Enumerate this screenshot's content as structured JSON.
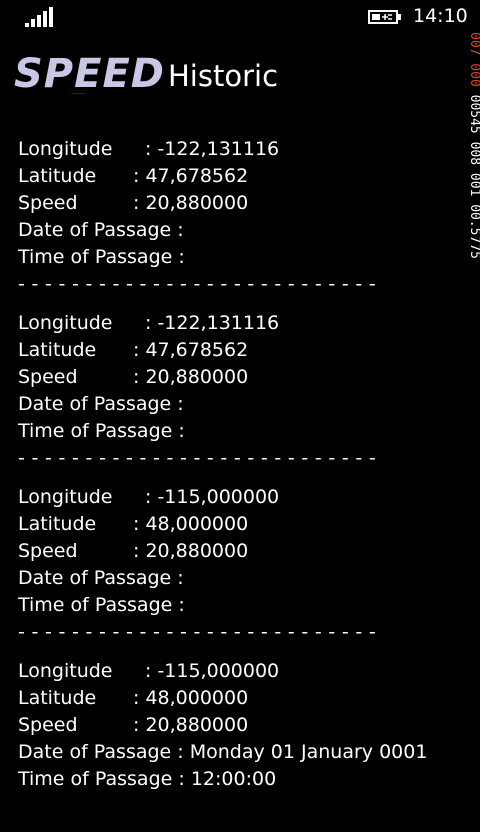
{
  "status_bar": {
    "time": "14:10",
    "icons": [
      "signal-strength-icon",
      "battery-charging-icon"
    ]
  },
  "header": {
    "logo_text": "SPEED",
    "logo_tagline": "..........",
    "title": "Historic"
  },
  "records": [
    {
      "longitude_label": "Longitude",
      "longitude_value": ": -122,131116",
      "latitude_label": "Latitude",
      "latitude_value": ": 47,678562",
      "speed_label": "Speed",
      "speed_value": ": 20,880000",
      "date_label": "Date of Passage :",
      "date_value": "",
      "time_label": "Time of Passage :",
      "time_value": ""
    },
    {
      "longitude_label": "Longitude",
      "longitude_value": ": -122,131116",
      "latitude_label": "Latitude",
      "latitude_value": ": 47,678562",
      "speed_label": "Speed",
      "speed_value": ": 20,880000",
      "date_label": "Date of Passage :",
      "date_value": "",
      "time_label": "Time of Passage :",
      "time_value": ""
    },
    {
      "longitude_label": "Longitude",
      "longitude_value": ": -115,000000",
      "latitude_label": "Latitude",
      "latitude_value": ": 48,000000",
      "speed_label": "Speed",
      "speed_value": ": 20,880000",
      "date_label": "Date of Passage :",
      "date_value": "",
      "time_label": "Time of Passage :",
      "time_value": ""
    },
    {
      "longitude_label": "Longitude",
      "longitude_value": ": -115,000000",
      "latitude_label": "Latitude",
      "latitude_value": ": 48,000000",
      "speed_label": "Speed",
      "speed_value": ": 20,880000",
      "date_label": "Date of Passage :",
      "date_value": "Monday 01 January 0001",
      "time_label": "Time of Passage :",
      "time_value": "12:00:00"
    }
  ],
  "separator": "- - - - - - - - - - - - - - - - - - - - - - - - - - -",
  "side_counter": {
    "part1": "007 000",
    "part2": "00545 008 001 00.5775"
  },
  "colors": {
    "background": "#000000",
    "text": "#ffffff",
    "logo": "#c9c7e6",
    "counter_accent": "#e0442c"
  }
}
